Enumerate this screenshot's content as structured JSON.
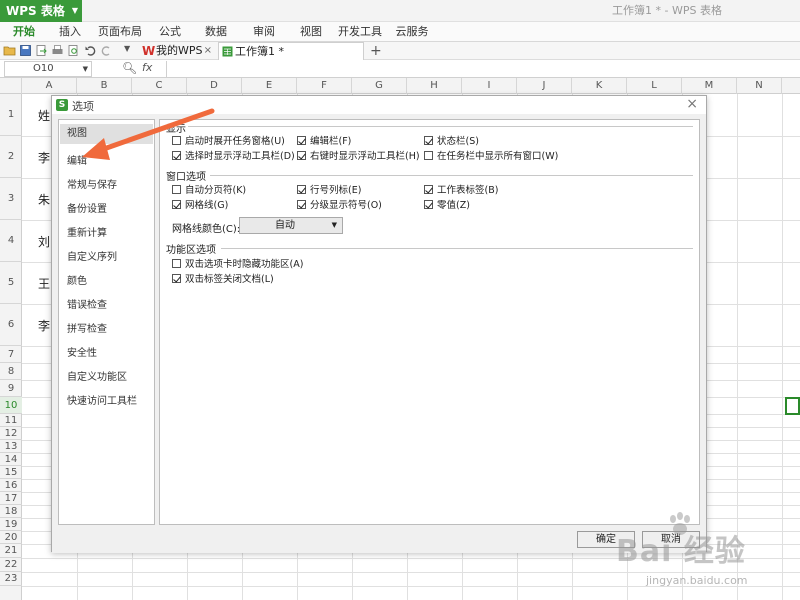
{
  "window": {
    "app_logo": "WPS 表格",
    "title": "工作簿1 * - WPS 表格"
  },
  "ribbon_tabs": [
    "开始",
    "插入",
    "页面布局",
    "公式",
    "数据",
    "审阅",
    "视图",
    "开发工具",
    "云服务"
  ],
  "doc_tabs": {
    "mywps": "我的WPS",
    "workbook": "工作簿1 *",
    "close_glyph": "×",
    "add_glyph": "+"
  },
  "formula_bar": {
    "cell_ref": "O10",
    "fx_label": "fx"
  },
  "columns": [
    "A",
    "B",
    "C",
    "D",
    "E",
    "F",
    "G",
    "H",
    "I",
    "J",
    "K",
    "L",
    "M",
    "N"
  ],
  "rows": [
    "1",
    "2",
    "3",
    "4",
    "5",
    "6",
    "7",
    "8",
    "9",
    "10",
    "11",
    "12",
    "13",
    "14",
    "15",
    "16",
    "17",
    "18",
    "19",
    "20",
    "21",
    "22",
    "23"
  ],
  "selected_row": "10",
  "cells_col_a": [
    "姓",
    "李",
    "朱",
    "刘",
    "王",
    "李"
  ],
  "dialog": {
    "title": "选项",
    "close_glyph": "×",
    "nav_items": [
      "视图",
      "编辑",
      "常规与保存",
      "备份设置",
      "重新计算",
      "自定义序列",
      "颜色",
      "错误检查",
      "拼写检查",
      "安全性",
      "自定义功能区",
      "快速访问工具栏"
    ],
    "active_nav": "视图",
    "groups": {
      "display": {
        "title": "显示",
        "options": [
          {
            "label": "启动时展开任务窗格(U)",
            "checked": false
          },
          {
            "label": "编辑栏(F)",
            "checked": true
          },
          {
            "label": "状态栏(S)",
            "checked": true
          },
          {
            "label": "选择时显示浮动工具栏(D)",
            "checked": true
          },
          {
            "label": "右键时显示浮动工具栏(H)",
            "checked": true
          },
          {
            "label": "在任务栏中显示所有窗口(W)",
            "checked": false
          }
        ]
      },
      "window": {
        "title": "窗口选项",
        "options": [
          {
            "label": "自动分页符(K)",
            "checked": false
          },
          {
            "label": "行号列标(E)",
            "checked": true
          },
          {
            "label": "工作表标签(B)",
            "checked": true
          },
          {
            "label": "网格线(G)",
            "checked": true
          },
          {
            "label": "分级显示符号(O)",
            "checked": true
          },
          {
            "label": "零值(Z)",
            "checked": true
          }
        ],
        "gridcolor_label": "网格线颜色(C):",
        "gridcolor_value": "自动"
      },
      "ribbon": {
        "title": "功能区选项",
        "options": [
          {
            "label": "双击选项卡时隐藏功能区(A)",
            "checked": false
          },
          {
            "label": "双击标签关闭文档(L)",
            "checked": true
          }
        ]
      }
    },
    "ok_label": "确定",
    "cancel_label": "取消"
  },
  "watermark": {
    "main": "Bai 经验",
    "sub": "jingyan.baidu.com"
  },
  "colors": {
    "brand_green": "#3a9a3a",
    "arrow": "#f06a3c"
  }
}
